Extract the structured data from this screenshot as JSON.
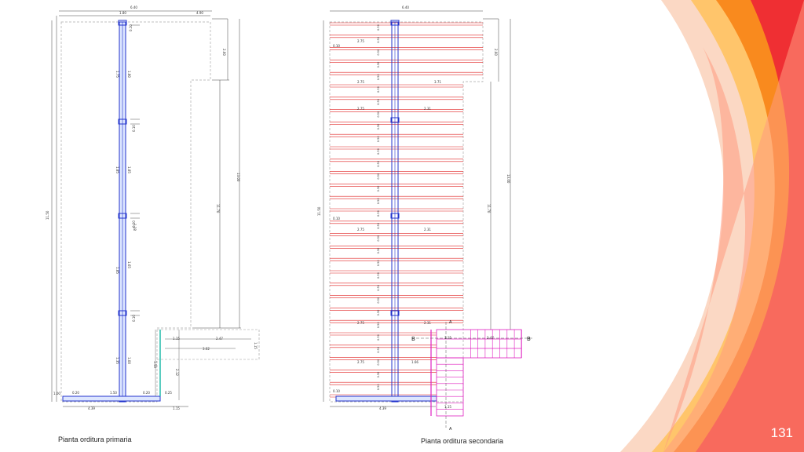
{
  "slide": {
    "page_number": "131",
    "accent_colors": [
      "#ffc56b",
      "#f98a1e",
      "#e8561e",
      "#ef2f33",
      "#ff9a80"
    ]
  },
  "left_plan": {
    "caption": "Pianta orditura primaria",
    "dims": {
      "top_total": "6.40",
      "top_a": "1.80",
      "top_b": "4.90",
      "right_h": "2.60",
      "left_h": "11.50",
      "right_long": "13.00",
      "right_mid": "11.70",
      "v1": "1.75",
      "v1b": "1.80",
      "v2": "1.85",
      "v2b": "1.85",
      "v3": "1.28",
      "v4": "1.85",
      "v4b": "1.65",
      "v5": "1.35",
      "v5b": "1.00",
      "s1": "0.10",
      "s2": "0.10",
      "s3": "0.10",
      "s4": "0.10",
      "bot_total": "4.39",
      "bot_a": "1.00",
      "bot_b": "0.20",
      "bot_c": "1.50",
      "bot_d": "0.20",
      "bot_e": "0.25",
      "bot_f": "1.15",
      "ext_a": "1.15",
      "ext_b": "2.47",
      "ext_c": "3.62",
      "ext_d": "1.15",
      "ext_e": "1.50",
      "ext_f": "2.12"
    }
  },
  "right_plan": {
    "caption": "Pianta orditura secondaria",
    "dims": {
      "top_total": "6.40",
      "right_h": "2.60",
      "left_h": "11.50",
      "right_long": "13.00",
      "right_mid": "11.70",
      "joist_spacing": "0.50",
      "row_a1": "2.75",
      "row_a0": "0.10",
      "row_b1": "2.75",
      "row_b2": "3.71",
      "row_c1": "2.75",
      "row_c2": "2.31",
      "row_d0": "0.10",
      "row_d1": "2.75",
      "row_d2": "2.31",
      "row_e1": "2.75",
      "row_e2": "2.31",
      "row_f1": "2.75",
      "row_f2": "1.66",
      "bot_s": "0.10",
      "bot_total": "4.39",
      "stair_a": "1.15",
      "stair_b": "2.47",
      "stair_c": "1.15"
    },
    "section_labels": {
      "b_left": "B",
      "b_right": "B",
      "a_top": "A",
      "a_bottom": "A"
    }
  }
}
